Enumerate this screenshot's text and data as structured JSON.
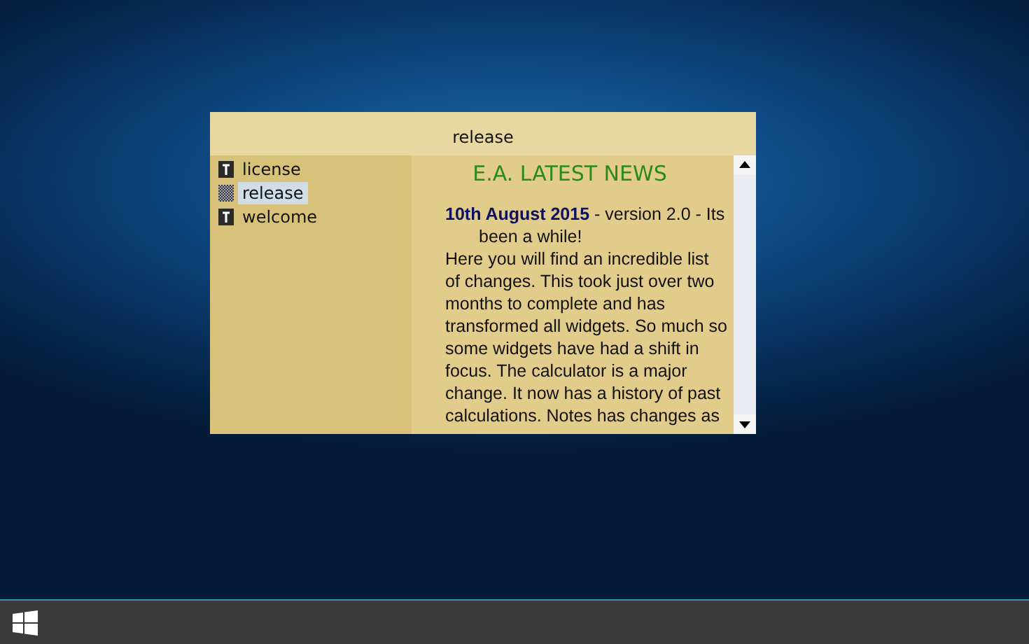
{
  "window": {
    "title": "release"
  },
  "files": [
    {
      "label": "license",
      "kind": "text",
      "selected": false
    },
    {
      "label": "release",
      "kind": "pattern",
      "selected": true
    },
    {
      "label": "welcome",
      "kind": "text",
      "selected": false
    }
  ],
  "content": {
    "heading": "E.A. LATEST NEWS",
    "intro": "**10th August 2015** - version 2.0 - Its been a while!",
    "body": "Here you will find an incredible list of changes. This took just over two months to complete and has transformed all widgets. So much so some widgets have had a shift in focus. The calculator is a major change. It now has a history of past calculations. Notes has changes as"
  }
}
